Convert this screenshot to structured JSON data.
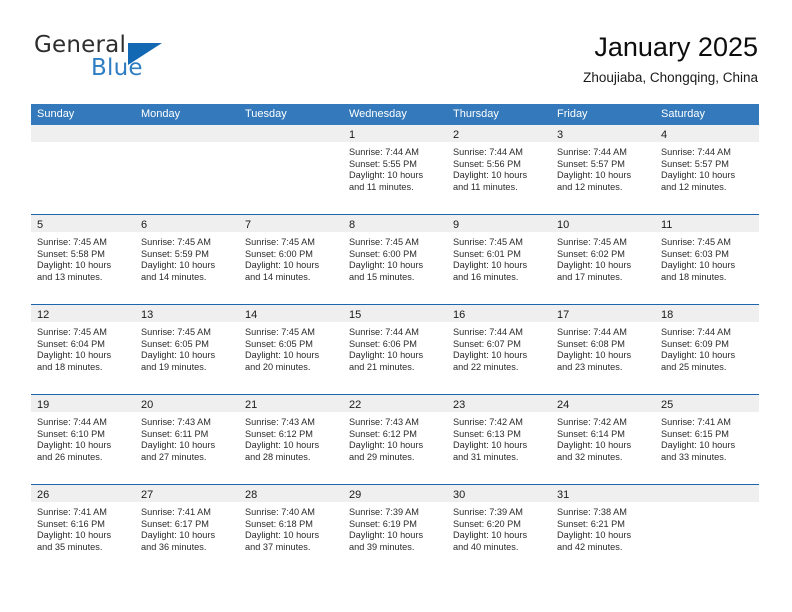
{
  "brand": {
    "name_primary": "General",
    "name_secondary": "Blue",
    "logo_icon": "blue-triangle-icon"
  },
  "header": {
    "title": "January 2025",
    "subtitle": "Zhoujiaba, Chongqing, China"
  },
  "theme": {
    "header_blue": "#3479bb",
    "rule_blue": "#1b66ad",
    "daynum_band": "#efefef",
    "brand_blue": "#2f7dc2"
  },
  "weekdays": [
    "Sunday",
    "Monday",
    "Tuesday",
    "Wednesday",
    "Thursday",
    "Friday",
    "Saturday"
  ],
  "weeks": [
    [
      {
        "day": "",
        "sunrise": "",
        "sunset": "",
        "daylight": "",
        "daylight2": ""
      },
      {
        "day": "",
        "sunrise": "",
        "sunset": "",
        "daylight": "",
        "daylight2": ""
      },
      {
        "day": "",
        "sunrise": "",
        "sunset": "",
        "daylight": "",
        "daylight2": ""
      },
      {
        "day": "1",
        "sunrise": "Sunrise: 7:44 AM",
        "sunset": "Sunset: 5:55 PM",
        "daylight": "Daylight: 10 hours",
        "daylight2": "and 11 minutes."
      },
      {
        "day": "2",
        "sunrise": "Sunrise: 7:44 AM",
        "sunset": "Sunset: 5:56 PM",
        "daylight": "Daylight: 10 hours",
        "daylight2": "and 11 minutes."
      },
      {
        "day": "3",
        "sunrise": "Sunrise: 7:44 AM",
        "sunset": "Sunset: 5:57 PM",
        "daylight": "Daylight: 10 hours",
        "daylight2": "and 12 minutes."
      },
      {
        "day": "4",
        "sunrise": "Sunrise: 7:44 AM",
        "sunset": "Sunset: 5:57 PM",
        "daylight": "Daylight: 10 hours",
        "daylight2": "and 12 minutes."
      }
    ],
    [
      {
        "day": "5",
        "sunrise": "Sunrise: 7:45 AM",
        "sunset": "Sunset: 5:58 PM",
        "daylight": "Daylight: 10 hours",
        "daylight2": "and 13 minutes."
      },
      {
        "day": "6",
        "sunrise": "Sunrise: 7:45 AM",
        "sunset": "Sunset: 5:59 PM",
        "daylight": "Daylight: 10 hours",
        "daylight2": "and 14 minutes."
      },
      {
        "day": "7",
        "sunrise": "Sunrise: 7:45 AM",
        "sunset": "Sunset: 6:00 PM",
        "daylight": "Daylight: 10 hours",
        "daylight2": "and 14 minutes."
      },
      {
        "day": "8",
        "sunrise": "Sunrise: 7:45 AM",
        "sunset": "Sunset: 6:00 PM",
        "daylight": "Daylight: 10 hours",
        "daylight2": "and 15 minutes."
      },
      {
        "day": "9",
        "sunrise": "Sunrise: 7:45 AM",
        "sunset": "Sunset: 6:01 PM",
        "daylight": "Daylight: 10 hours",
        "daylight2": "and 16 minutes."
      },
      {
        "day": "10",
        "sunrise": "Sunrise: 7:45 AM",
        "sunset": "Sunset: 6:02 PM",
        "daylight": "Daylight: 10 hours",
        "daylight2": "and 17 minutes."
      },
      {
        "day": "11",
        "sunrise": "Sunrise: 7:45 AM",
        "sunset": "Sunset: 6:03 PM",
        "daylight": "Daylight: 10 hours",
        "daylight2": "and 18 minutes."
      }
    ],
    [
      {
        "day": "12",
        "sunrise": "Sunrise: 7:45 AM",
        "sunset": "Sunset: 6:04 PM",
        "daylight": "Daylight: 10 hours",
        "daylight2": "and 18 minutes."
      },
      {
        "day": "13",
        "sunrise": "Sunrise: 7:45 AM",
        "sunset": "Sunset: 6:05 PM",
        "daylight": "Daylight: 10 hours",
        "daylight2": "and 19 minutes."
      },
      {
        "day": "14",
        "sunrise": "Sunrise: 7:45 AM",
        "sunset": "Sunset: 6:05 PM",
        "daylight": "Daylight: 10 hours",
        "daylight2": "and 20 minutes."
      },
      {
        "day": "15",
        "sunrise": "Sunrise: 7:44 AM",
        "sunset": "Sunset: 6:06 PM",
        "daylight": "Daylight: 10 hours",
        "daylight2": "and 21 minutes."
      },
      {
        "day": "16",
        "sunrise": "Sunrise: 7:44 AM",
        "sunset": "Sunset: 6:07 PM",
        "daylight": "Daylight: 10 hours",
        "daylight2": "and 22 minutes."
      },
      {
        "day": "17",
        "sunrise": "Sunrise: 7:44 AM",
        "sunset": "Sunset: 6:08 PM",
        "daylight": "Daylight: 10 hours",
        "daylight2": "and 23 minutes."
      },
      {
        "day": "18",
        "sunrise": "Sunrise: 7:44 AM",
        "sunset": "Sunset: 6:09 PM",
        "daylight": "Daylight: 10 hours",
        "daylight2": "and 25 minutes."
      }
    ],
    [
      {
        "day": "19",
        "sunrise": "Sunrise: 7:44 AM",
        "sunset": "Sunset: 6:10 PM",
        "daylight": "Daylight: 10 hours",
        "daylight2": "and 26 minutes."
      },
      {
        "day": "20",
        "sunrise": "Sunrise: 7:43 AM",
        "sunset": "Sunset: 6:11 PM",
        "daylight": "Daylight: 10 hours",
        "daylight2": "and 27 minutes."
      },
      {
        "day": "21",
        "sunrise": "Sunrise: 7:43 AM",
        "sunset": "Sunset: 6:12 PM",
        "daylight": "Daylight: 10 hours",
        "daylight2": "and 28 minutes."
      },
      {
        "day": "22",
        "sunrise": "Sunrise: 7:43 AM",
        "sunset": "Sunset: 6:12 PM",
        "daylight": "Daylight: 10 hours",
        "daylight2": "and 29 minutes."
      },
      {
        "day": "23",
        "sunrise": "Sunrise: 7:42 AM",
        "sunset": "Sunset: 6:13 PM",
        "daylight": "Daylight: 10 hours",
        "daylight2": "and 31 minutes."
      },
      {
        "day": "24",
        "sunrise": "Sunrise: 7:42 AM",
        "sunset": "Sunset: 6:14 PM",
        "daylight": "Daylight: 10 hours",
        "daylight2": "and 32 minutes."
      },
      {
        "day": "25",
        "sunrise": "Sunrise: 7:41 AM",
        "sunset": "Sunset: 6:15 PM",
        "daylight": "Daylight: 10 hours",
        "daylight2": "and 33 minutes."
      }
    ],
    [
      {
        "day": "26",
        "sunrise": "Sunrise: 7:41 AM",
        "sunset": "Sunset: 6:16 PM",
        "daylight": "Daylight: 10 hours",
        "daylight2": "and 35 minutes."
      },
      {
        "day": "27",
        "sunrise": "Sunrise: 7:41 AM",
        "sunset": "Sunset: 6:17 PM",
        "daylight": "Daylight: 10 hours",
        "daylight2": "and 36 minutes."
      },
      {
        "day": "28",
        "sunrise": "Sunrise: 7:40 AM",
        "sunset": "Sunset: 6:18 PM",
        "daylight": "Daylight: 10 hours",
        "daylight2": "and 37 minutes."
      },
      {
        "day": "29",
        "sunrise": "Sunrise: 7:39 AM",
        "sunset": "Sunset: 6:19 PM",
        "daylight": "Daylight: 10 hours",
        "daylight2": "and 39 minutes."
      },
      {
        "day": "30",
        "sunrise": "Sunrise: 7:39 AM",
        "sunset": "Sunset: 6:20 PM",
        "daylight": "Daylight: 10 hours",
        "daylight2": "and 40 minutes."
      },
      {
        "day": "31",
        "sunrise": "Sunrise: 7:38 AM",
        "sunset": "Sunset: 6:21 PM",
        "daylight": "Daylight: 10 hours",
        "daylight2": "and 42 minutes."
      },
      {
        "day": "",
        "sunrise": "",
        "sunset": "",
        "daylight": "",
        "daylight2": ""
      }
    ]
  ]
}
